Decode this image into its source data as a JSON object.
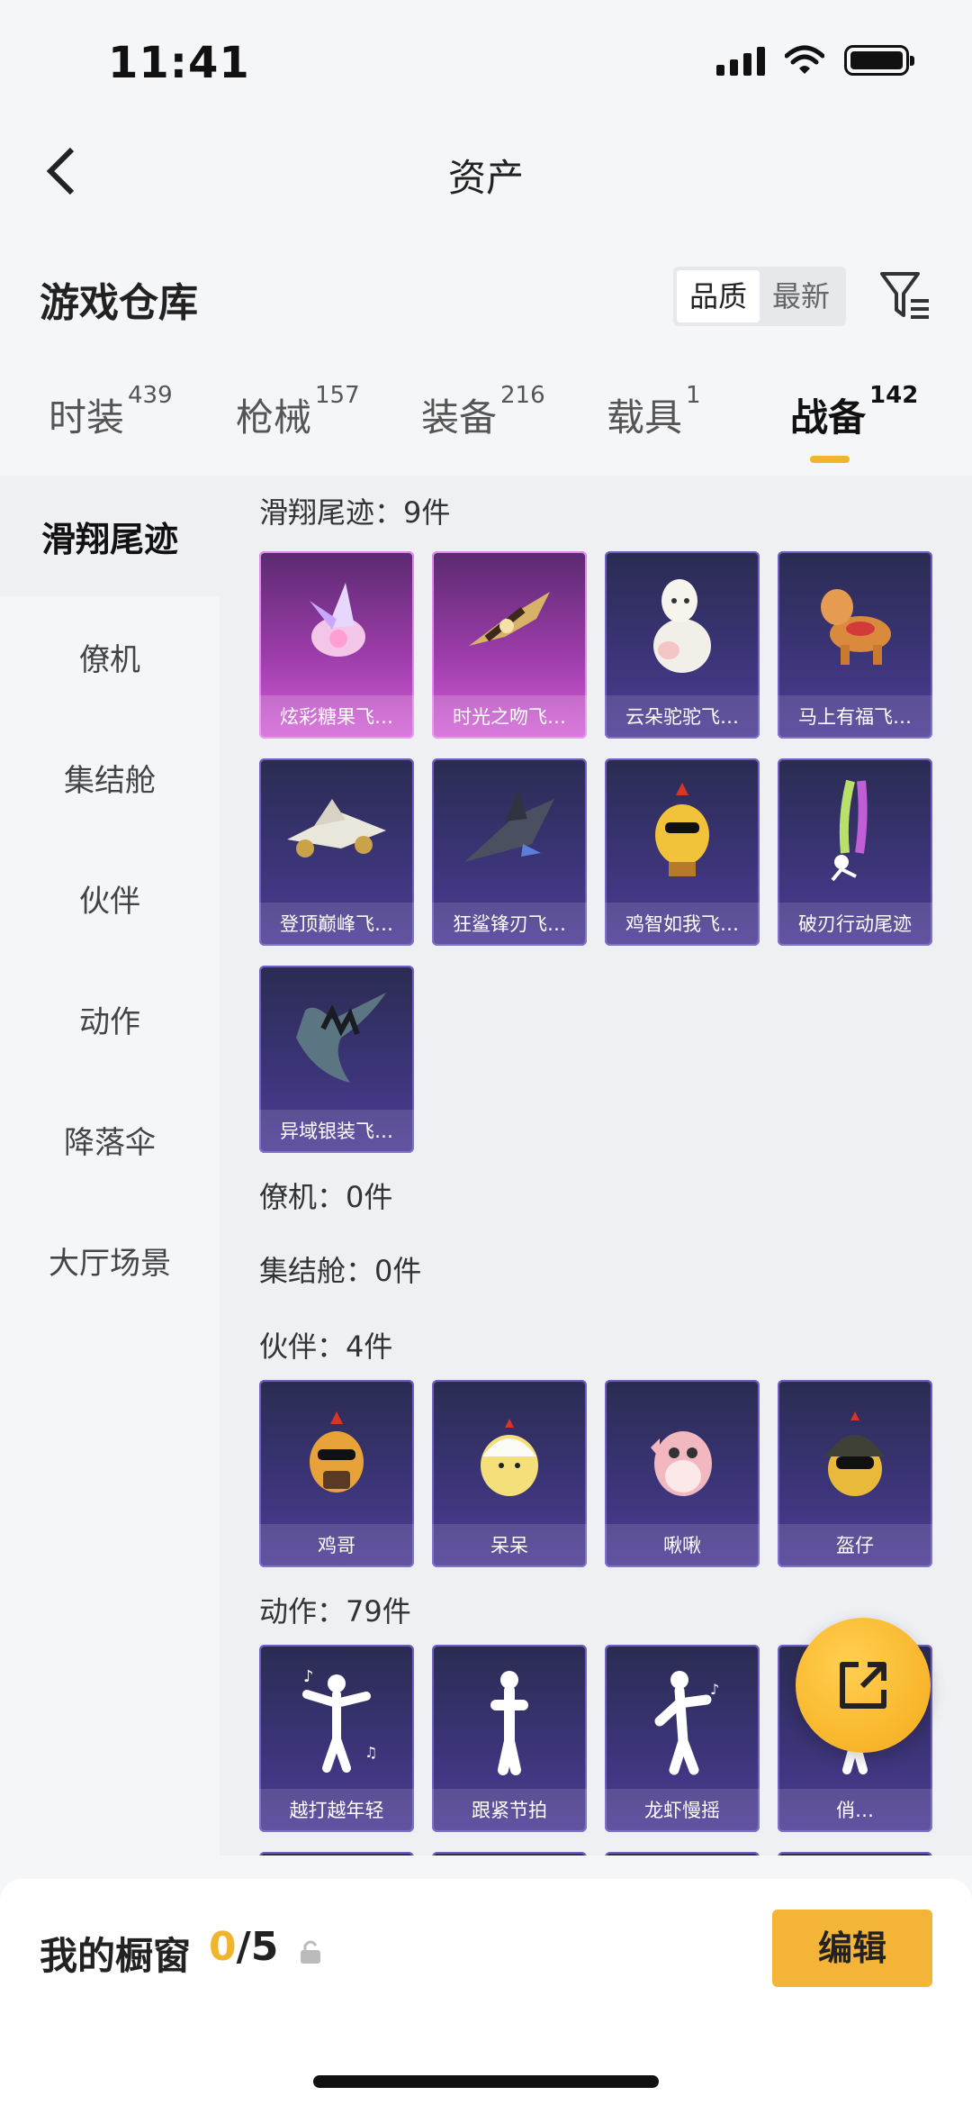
{
  "status": {
    "time": "11:41"
  },
  "nav": {
    "title": "资产"
  },
  "header": {
    "title": "游戏仓库",
    "sort_options": [
      "品质",
      "最新"
    ]
  },
  "tabs": [
    {
      "label": "时装",
      "count": "439"
    },
    {
      "label": "枪械",
      "count": "157"
    },
    {
      "label": "装备",
      "count": "216"
    },
    {
      "label": "载具",
      "count": "1"
    },
    {
      "label": "战备",
      "count": "142"
    }
  ],
  "sidebar": [
    "滑翔尾迹",
    "僚机",
    "集结舱",
    "伙伴",
    "动作",
    "降落伞",
    "大厅场景"
  ],
  "groups": {
    "glide": {
      "label": "滑翔尾迹：9件",
      "items": [
        "炫彩糖果飞…",
        "时光之吻飞…",
        "云朵驼驼飞…",
        "马上有福飞…",
        "登顶巅峰飞…",
        "狂鲨锋刃飞…",
        "鸡智如我飞…",
        "破刃行动尾迹",
        "异域银装飞…"
      ]
    },
    "wingman": {
      "label": "僚机：0件"
    },
    "assembly": {
      "label": "集结舱：0件"
    },
    "partner": {
      "label": "伙伴：4件",
      "items": [
        "鸡哥",
        "呆呆",
        "啾啾",
        "盔仔"
      ]
    },
    "emote": {
      "label": "动作：79件",
      "items": [
        "越打越年轻",
        "跟紧节拍",
        "龙虾慢摇",
        "俏…"
      ]
    }
  },
  "bottom": {
    "label": "我的橱窗",
    "current": "0",
    "total": "/5",
    "edit_label": "编辑"
  },
  "colors": {
    "accent": "#f0b52c",
    "card_dark": "#3b3477",
    "card_pink": "#9c3ca9"
  }
}
